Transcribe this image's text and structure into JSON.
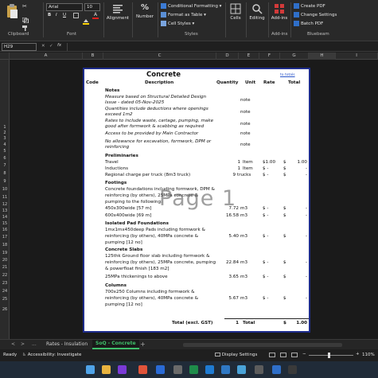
{
  "ribbon": {
    "font_name": "Arial",
    "font_size": "10",
    "clipboard_label": "Clipboard",
    "font_label": "Font",
    "alignment_label": "Alignment",
    "number_label": "Number",
    "conditional_formatting": "Conditional Formatting",
    "format_as_table": "Format as Table",
    "cell_styles": "Cell Styles",
    "styles_label": "Styles",
    "cells_label": "Cells",
    "editing_label": "Editing",
    "addins_label": "Add-ins",
    "addins_group_label": "Add-ins",
    "create_pdf": "Create PDF",
    "change_settings": "Change Settings",
    "batch_pdf": "Batch PDF",
    "bluebeam_label": "Bluebeam"
  },
  "formula_bar": {
    "name_box": "H29",
    "fx": "fx",
    "formula": ""
  },
  "columns": [
    "A",
    "B",
    "C",
    "D",
    "E",
    "F",
    "G",
    "H",
    "I"
  ],
  "rows": [
    "1",
    "2",
    "3",
    "4",
    "5",
    "6",
    "7",
    "8",
    "9",
    "10",
    "11",
    "12",
    "13",
    "14",
    "15",
    "16",
    "17",
    "18",
    "19",
    "20",
    "21",
    "22",
    "23",
    "24",
    "25",
    "26"
  ],
  "doc": {
    "title": "Concrete",
    "link": "to totals",
    "headers": {
      "code": "Code",
      "description": "Description",
      "quantity": "Quantity",
      "unit": "Unit",
      "rate": "Rate",
      "total": "Total"
    },
    "notes_heading": "Notes",
    "notes": [
      {
        "text": [
          "Measure based on Structural Detailed Design",
          "Issue - dated 05-Nov-2025"
        ],
        "note": "note"
      },
      {
        "text": [
          "Quantities include deductions where openings",
          "exceed 1m2"
        ],
        "note": "note"
      },
      {
        "text": [
          "Rates to include waste, cartage, pumping, make",
          "good after formwork & scabbing as required"
        ],
        "note": "note"
      },
      {
        "text": [
          "Access to be provided by Main Contractor"
        ],
        "note": "note"
      },
      {
        "text": [
          "No allowance for excavation, formwork, DPM or",
          "reinforcing"
        ],
        "note": "note"
      }
    ],
    "prelim_heading": "Preliminaries",
    "prelims": [
      {
        "desc": "Travel",
        "qty": "1",
        "unit": "Item",
        "rate": "$1.00",
        "total_s": "$",
        "total": "1.00"
      },
      {
        "desc": "Inductions",
        "qty": "1",
        "unit": "Item",
        "rate": "$  -",
        "total_s": "$",
        "total": "-"
      },
      {
        "desc": "Regional charge per truck (8m3 truck)",
        "qty": "9",
        "unit": "trucks",
        "rate": "$  -",
        "total_s": "$",
        "total": "-"
      }
    ],
    "footings_heading": "Footings",
    "footings_text": [
      "Concrete foundations including formwork, DPM &",
      "reinforcing (by others), 25MPa concrete &",
      "pumping to the following:"
    ],
    "footings": [
      {
        "desc": "450x300wide  [57 m]",
        "qty": "7.72",
        "unit": "m3",
        "rate": "$  -",
        "total_s": "$",
        "total": "-"
      },
      {
        "desc": "600x400wide  [69 m]",
        "qty": "16.58",
        "unit": "m3",
        "rate": "$  -",
        "total_s": "$",
        "total": "-"
      }
    ],
    "pads_heading": "Isolated Pad Foundations",
    "pads_text": [
      "1mx1mx450deep Pads including formwork &",
      "reinforcing (by others), 40MPa concrete &",
      "pumping  [12 no]"
    ],
    "pads": {
      "qty": "5.40",
      "unit": "m3",
      "rate": "$  -",
      "total_s": "$",
      "total": "-"
    },
    "slabs_heading": "Concrete Slabs",
    "slabs_text": [
      "125thk Ground floor slab including formwork &",
      "reinforcing (by others), 25MPa concrete, pumping",
      "& powerfloat finish       [183 m2]"
    ],
    "slabs": {
      "qty": "22.84",
      "unit": "m3",
      "rate": "$  -",
      "total_s": "$",
      "total": "-"
    },
    "thick_text": "25MPa thickenings to above",
    "thick": {
      "qty": "3.65",
      "unit": "m3",
      "rate": "$  -",
      "total_s": "$",
      "total": "-"
    },
    "columns_heading": "Columns",
    "columns_text": [
      "700x250 Columns including formwork &",
      "reinforcing (by others), 40MPa concrete &",
      "pumping  [12 no]"
    ],
    "columns_row": {
      "qty": "5.67",
      "unit": "m3",
      "rate": "$  -",
      "total_s": "$",
      "total": "-"
    },
    "total_label": "Total (excl. GST)",
    "total_qty": "1",
    "total_unit": "Total",
    "total_s": "$",
    "total_value": "1.00"
  },
  "watermark": "Page 1",
  "tabs": {
    "prev": "...",
    "tab1": "Rates - Insulation",
    "tab2": "SoQ - Concrete",
    "add": "+"
  },
  "status": {
    "ready": "Ready",
    "accessibility": "Accessibility: Investigate",
    "display_settings": "Display Settings",
    "zoom": "110%"
  }
}
